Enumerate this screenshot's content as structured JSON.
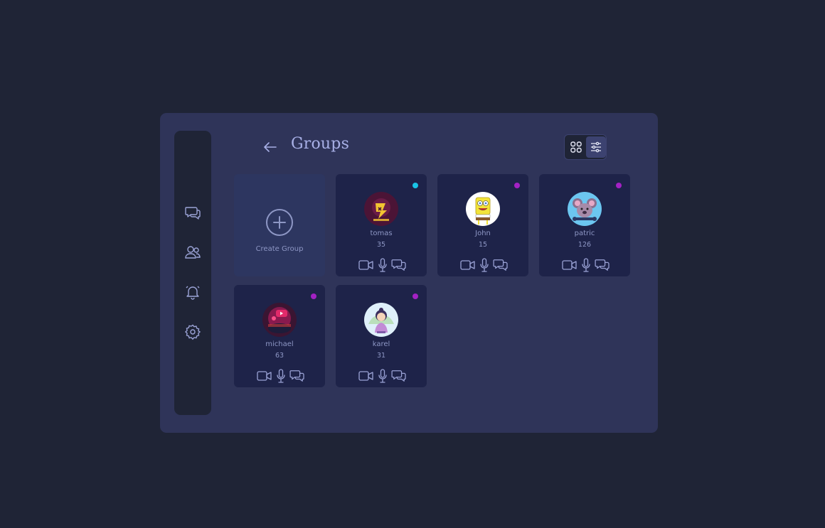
{
  "header": {
    "title": "Groups"
  },
  "sidebar": {
    "items": [
      {
        "icon": "chat-icon"
      },
      {
        "icon": "users-icon"
      },
      {
        "icon": "bell-icon"
      },
      {
        "icon": "settings-icon"
      }
    ]
  },
  "view_toggle": {
    "options": [
      {
        "icon": "grid-icon",
        "selected": false
      },
      {
        "icon": "sliders-icon",
        "selected": true
      }
    ]
  },
  "create_card": {
    "label": "Create Group"
  },
  "groups": [
    {
      "name": "tomas",
      "count": "35",
      "status_color": "#19c4e6"
    },
    {
      "name": "John",
      "count": "15",
      "status_color": "#a321c4"
    },
    {
      "name": "patric",
      "count": "126",
      "status_color": "#a321c4"
    },
    {
      "name": "michael",
      "count": "63",
      "status_color": "#a321c4"
    },
    {
      "name": "karel",
      "count": "31",
      "status_color": "#a321c4"
    }
  ],
  "colors": {
    "background": "#1f2436",
    "panel": "#2f3459",
    "card": "#1e2349",
    "accent_text": "#a8b0e6"
  }
}
